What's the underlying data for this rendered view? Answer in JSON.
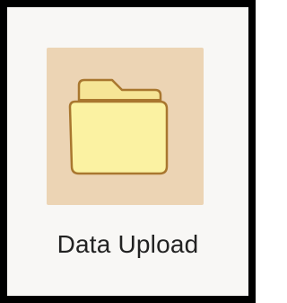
{
  "desktop_item": {
    "label": "Data Upload",
    "icon": "folder-icon"
  },
  "colors": {
    "frame_border": "#000000",
    "background": "#f8f7f5",
    "tile": "#ecd4b4",
    "folder_fill": "#fbf2a2",
    "folder_back": "#f6e596",
    "folder_outline": "#a9772f",
    "label_text": "#222222"
  }
}
